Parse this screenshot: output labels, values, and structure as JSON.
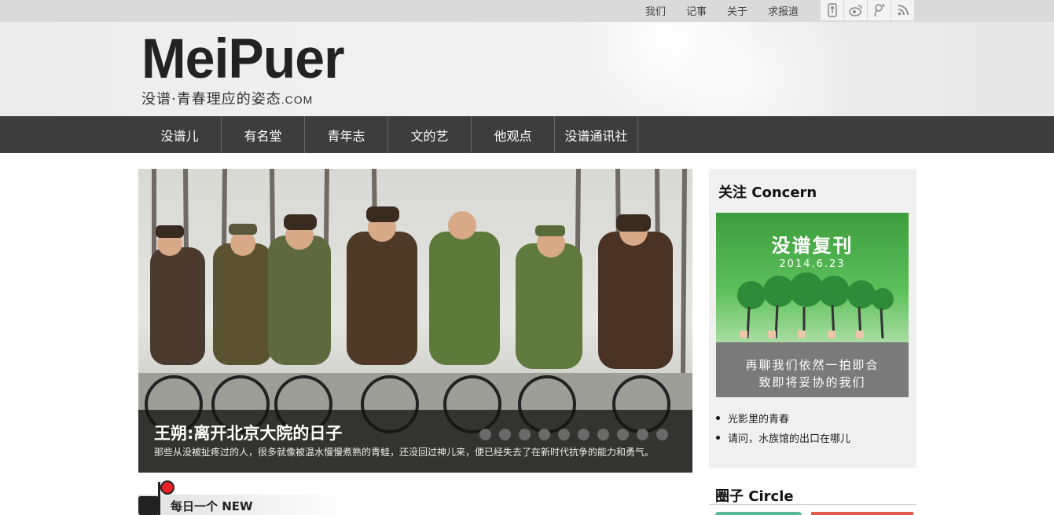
{
  "topbar": {
    "links": [
      "我们",
      "记事",
      "关于",
      "求报道"
    ],
    "social_icons": [
      "mobile-icon",
      "weibo-icon",
      "tencent-weibo-icon",
      "rss-icon"
    ]
  },
  "header": {
    "logo_text": "MeiPuer",
    "tagline": "没谱·青春理应的姿态",
    "tagline_suffix": ".COM"
  },
  "nav": {
    "items": [
      "没谱儿",
      "有名堂",
      "青年志",
      "文的艺",
      "他观点",
      "没谱通讯社"
    ]
  },
  "slider": {
    "title": "王朔:离开北京大院的日子",
    "text": "那些从没被扯疼过的人，很多就像被温水慢慢煮熟的青蛙，还没回过神儿来，便已经失去了在新时代抗争的能力和勇气。",
    "dot_count": 10
  },
  "daily": {
    "label": "每日一个 NEW"
  },
  "concern": {
    "title": "关注  Concern",
    "promo_title": "没谱复刊",
    "promo_date": "2014.6.23",
    "promo_line1": "再聊我们依然一拍即合",
    "promo_line2": "致即将妥协的我们",
    "links": [
      "光影里的青春",
      "请问，水族馆的出口在哪儿"
    ]
  },
  "circle": {
    "title": "圈子  Circle"
  },
  "colors": {
    "nav_bg": "#3d3d3d",
    "topbar_bg": "#dadada",
    "promo_green": "#4caf50",
    "flag_red": "#e8202a"
  }
}
